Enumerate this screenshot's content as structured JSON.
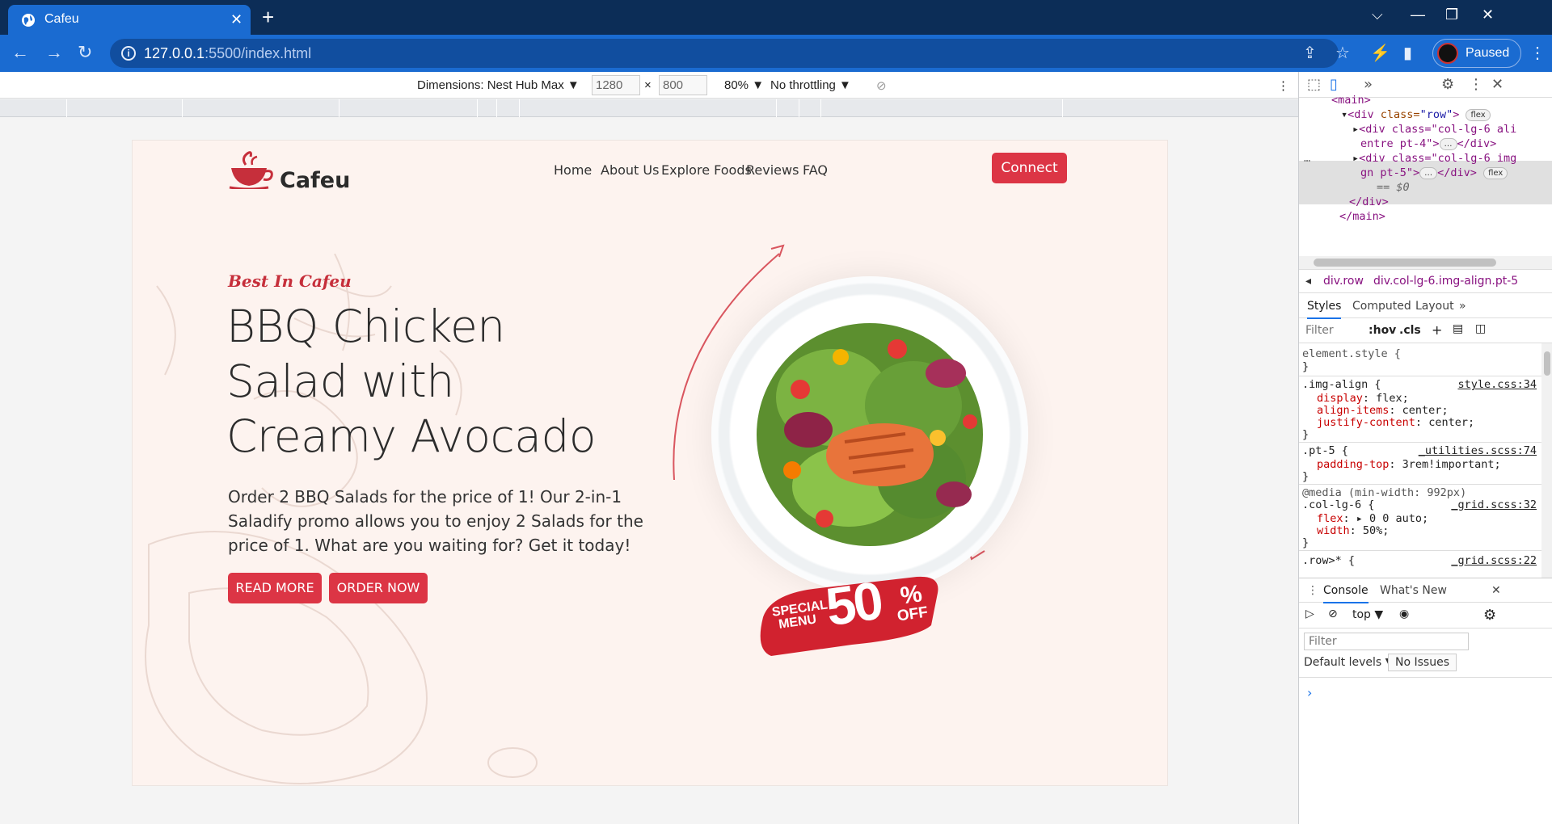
{
  "browser": {
    "tab_title": "Cafeu",
    "tab_close": "✕",
    "new_tab": "+",
    "window_controls": [
      "⌵",
      "—",
      "❐",
      "✕"
    ],
    "nav": {
      "back": "←",
      "forward": "→",
      "reload": "↻"
    },
    "url_host": "127.0.0.1",
    "url_rest": ":5500/index.html",
    "profile_label": "Paused"
  },
  "device_toolbar": {
    "dimensions_label": "Dimensions: Nest Hub Max ▼",
    "width": "1280",
    "times": "×",
    "height": "800",
    "zoom": "80% ▼",
    "throttling": "No throttling ▼",
    "more": "⋮"
  },
  "site": {
    "brand": "Cafeu",
    "nav": [
      "Home",
      "About Us",
      "Explore Foods",
      "Reviews",
      "FAQ"
    ],
    "connect": "Connect",
    "kicker": "Best In Cafeu",
    "headline": [
      "BBQ Chicken",
      "Salad with",
      "Creamy Avocado"
    ],
    "description": "Order 2 BBQ Salads for the price of 1! Our 2-in-1 Saladify promo allows you to enjoy 2 Salads for the price of 1. What are you waiting for? Get it today!",
    "buttons": {
      "read_more": "READ MORE",
      "order_now": "ORDER NOW"
    },
    "promo": {
      "special": "SPECIAL",
      "menu": "MENU",
      "value": "50",
      "percent": "%",
      "off": "OFF"
    },
    "accent_color": "#dc3545"
  },
  "devtools": {
    "dom_lines": {
      "main_open": "<main>",
      "row_open_tag": "<div ",
      "row_attr": "class=",
      "row_val": "\"row\"",
      "row_end": ">",
      "flex": "flex",
      "col1_a": "<div class=\"col-lg-6 ali",
      "col1_b": "entre pt-4\">",
      "col1_c": "</div>",
      "col2_a": "<div class=\"col-lg-6 img",
      "col2_b": "gn pt-5\">",
      "col2_c": "</div>",
      "dollar": "== $0",
      "div_close": "</div>",
      "main_close": "</main>",
      "ellipsis": "…",
      "gutter": "…"
    },
    "breadcrumbs": [
      "div.row",
      "div.col-lg-6.img-align.pt-5"
    ],
    "subtabs": [
      "Styles",
      "Computed",
      "Layout",
      "»"
    ],
    "filter_placeholder": "Filter",
    "filter_hov": ":hov",
    "filter_cls": ".cls",
    "filter_plus": "+",
    "rules": {
      "element_style": "element.style {",
      "close": "}",
      "img_align_sel": ".img-align {",
      "img_align_src": "style.css:34",
      "display": "display",
      "display_val": "flex;",
      "align_items": "align-items",
      "align_items_val": "center;",
      "justify": "justify-content",
      "justify_val": "center;",
      "pt5_sel": ".pt-5 {",
      "pt5_src": "_utilities.scss:74",
      "padding_top": "padding-top",
      "padding_top_val": "3rem!important;",
      "media": "@media (min-width: 992px)",
      "col_sel": ".col-lg-6 {",
      "col_src": "_grid.scss:32",
      "flex_prop": "flex",
      "flex_val": "▸ 0 0 auto;",
      "width_prop": "width",
      "width_val": "50%;",
      "row_sel": ".row>* {",
      "row_src": "_grid.scss:22"
    },
    "drawer_tabs": [
      "Console",
      "What's New"
    ],
    "console_context": "top ▼",
    "console_filter": "Filter",
    "default_levels": "Default levels ▼",
    "no_issues": "No Issues",
    "prompt": "›"
  }
}
